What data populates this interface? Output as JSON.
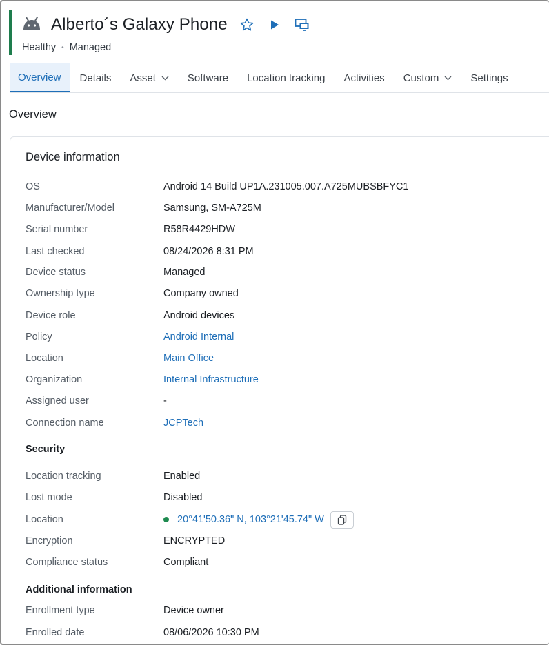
{
  "header": {
    "title": "Alberto´s Galaxy Phone",
    "health": "Healthy",
    "separator": "•",
    "management": "Managed"
  },
  "tabs": [
    {
      "label": "Overview",
      "active": true
    },
    {
      "label": "Details"
    },
    {
      "label": "Asset",
      "dropdown": true
    },
    {
      "label": "Software"
    },
    {
      "label": "Location tracking"
    },
    {
      "label": "Activities"
    },
    {
      "label": "Custom",
      "dropdown": true
    },
    {
      "label": "Settings"
    }
  ],
  "page_section": "Overview",
  "device_info": {
    "heading": "Device information",
    "rows": [
      {
        "label": "OS",
        "value": "Android 14 Build UP1A.231005.007.A725MUBSBFYC1"
      },
      {
        "label": "Manufacturer/Model",
        "value": "Samsung, SM-A725M"
      },
      {
        "label": "Serial number",
        "value": "R58R4429HDW"
      },
      {
        "label": "Last checked",
        "value": "08/24/2026 8:31 PM"
      },
      {
        "label": "Device status",
        "value": "Managed"
      },
      {
        "label": "Ownership type",
        "value": "Company owned"
      },
      {
        "label": "Device role",
        "value": "Android devices"
      },
      {
        "label": "Policy",
        "value": "Android Internal"
      },
      {
        "label": "Location",
        "value": "Main Office"
      },
      {
        "label": "Organization",
        "value": "Internal Infrastructure"
      },
      {
        "label": "Assigned user",
        "value": "-"
      },
      {
        "label": "Connection name",
        "value": "JCPTech"
      }
    ]
  },
  "security": {
    "heading": "Security",
    "rows": [
      {
        "label": "Location tracking",
        "value": "Enabled"
      },
      {
        "label": "Lost mode",
        "value": "Disabled"
      },
      {
        "label": "Location",
        "value": "20°41'50.36\" N, 103°21'45.74\" W"
      },
      {
        "label": "Encryption",
        "value": "ENCRYPTED"
      },
      {
        "label": "Compliance status",
        "value": "Compliant"
      }
    ]
  },
  "additional": {
    "heading": "Additional information",
    "rows": [
      {
        "label": "Enrollment type",
        "value": "Device owner"
      },
      {
        "label": "Enrolled date",
        "value": "08/06/2026 10:30 PM"
      }
    ]
  },
  "colors": {
    "accent": "#1f6fb8",
    "healthy": "#1e7d4d",
    "active_tab_bg": "#e8f1fb"
  },
  "icons": {
    "device": "android-icon",
    "favorite": "star-outline-icon",
    "run": "play-icon",
    "remote": "remote-control-icon",
    "copy": "copy-icon",
    "dropdown": "chevron-down-icon"
  }
}
